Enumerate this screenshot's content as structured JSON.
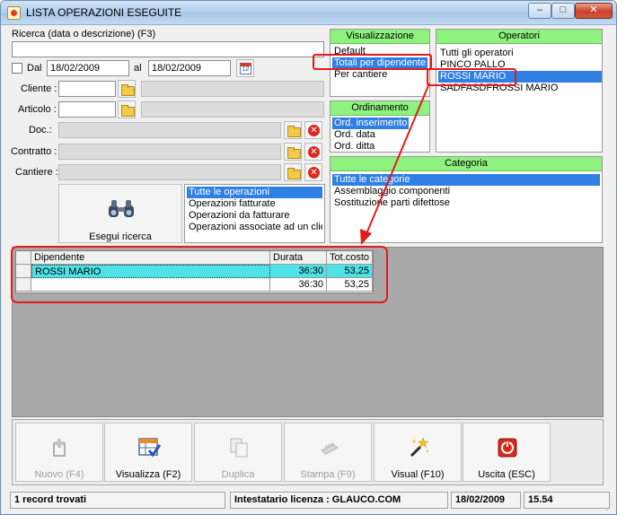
{
  "window": {
    "title": "LISTA OPERAZIONI ESEGUITE",
    "controls": {
      "minimize": "–",
      "maximize": "□",
      "close": "✕"
    }
  },
  "search": {
    "label": "Ricerca (data o descrizione) (F3)",
    "value": "",
    "dal_label": "Dal",
    "date_from": "18/02/2009",
    "al_label": "al",
    "date_to": "18/02/2009",
    "calendar_day": "12"
  },
  "filters": {
    "cliente_label": "Cliente :",
    "articolo_label": "Articolo :",
    "doc_label": "Doc.:",
    "contratto_label": "Contratto :",
    "cantiere_label": "Cantiere :"
  },
  "visualizzazione": {
    "title": "Visualizzazione",
    "items": [
      "Default",
      "Totali per dipendente",
      "Per cantiere"
    ],
    "selected": 1
  },
  "ordinamento": {
    "title": "Ordinamento",
    "items": [
      "Ord. inserimento",
      "Ord. data",
      "Ord. ditta"
    ],
    "selected": 0
  },
  "operatori": {
    "title": "Operatori",
    "items": [
      "Tutti gli operatori",
      "PINCO PALLO",
      "ROSSI MARIO",
      "SADFASDFROSSI MARIO"
    ],
    "selected": 2
  },
  "categoria": {
    "title": "Categoria",
    "items": [
      "Tutte le categorie",
      "Assemblaggio componenti",
      "Sostituzione parti difettose"
    ],
    "selected": 0
  },
  "search_button": {
    "label": "Esegui ricerca"
  },
  "operazioni": {
    "items": [
      "Tutte le operazioni",
      "Operazioni fatturate",
      "Operazioni da fatturare",
      "Operazioni associate ad un clier"
    ],
    "selected": 0
  },
  "grid": {
    "columns": [
      "Dipendente",
      "Durata",
      "Tot.costo"
    ],
    "rows": [
      [
        "ROSSI MARIO",
        "36:30",
        "53,25"
      ],
      [
        "",
        "36:30",
        "53,25"
      ]
    ]
  },
  "toolbar": {
    "buttons": [
      {
        "label": "Nuovo (F4)",
        "icon": "new-icon",
        "enabled": false
      },
      {
        "label": "Visualizza (F2)",
        "icon": "view-icon",
        "enabled": true
      },
      {
        "label": "Duplica",
        "icon": "duplicate-icon",
        "enabled": false
      },
      {
        "label": "Stampa (F9)",
        "icon": "print-icon",
        "enabled": false
      },
      {
        "label": "Visual (F10)",
        "icon": "magic-wand-icon",
        "enabled": true
      },
      {
        "label": "Uscita (ESC)",
        "icon": "exit-icon",
        "enabled": true
      }
    ]
  },
  "status": {
    "records": "1 record trovati",
    "license": "Intestatario licenza : GLAUCO.COM",
    "date": "18/02/2009",
    "time": "15.54"
  },
  "colors": {
    "panel_header": "#8ef27e",
    "selection": "#2f7fe4",
    "row_highlight": "#4fe3e8",
    "annotation": "#e51a1a"
  }
}
